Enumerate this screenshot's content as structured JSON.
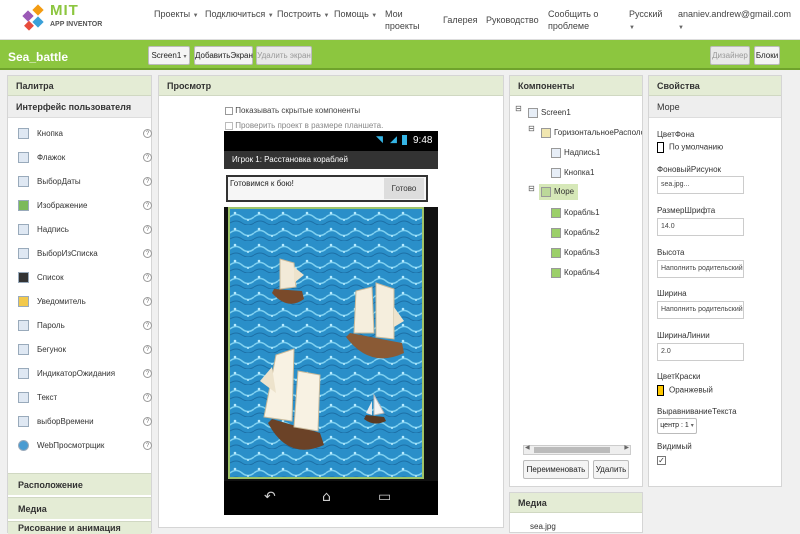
{
  "app": {
    "logo_top": "MIT",
    "logo_bottom": "APP INVENTOR"
  },
  "nav": [
    {
      "label": "Проекты",
      "dropdown": true
    },
    {
      "label": "Подключиться",
      "dropdown": true
    },
    {
      "label": "Построить",
      "dropdown": true
    },
    {
      "label": "Помощь",
      "dropdown": true
    },
    {
      "label": "Мои проекты",
      "dropdown": false
    },
    {
      "label": "Галерея",
      "dropdown": false
    },
    {
      "label": "Руководство",
      "dropdown": false
    },
    {
      "label": "Сообщить о проблеме",
      "dropdown": false
    },
    {
      "label": "Русский",
      "dropdown": true
    },
    {
      "label": "ananiev.andrew@gmail.com",
      "dropdown": true
    }
  ],
  "toolbar": {
    "project_name": "Sea_battle",
    "screen_select": "Screen1",
    "add_screen": "ДобавитьЭкран",
    "remove_screen": "Удалить экран",
    "designer": "Дизайнер",
    "blocks": "Блоки"
  },
  "palette": {
    "title": "Палитра",
    "section": "Интерфейс пользователя",
    "items": [
      {
        "label": "Кнопка",
        "icon": "button-icon"
      },
      {
        "label": "Флажок",
        "icon": "checkbox-icon"
      },
      {
        "label": "ВыборДаты",
        "icon": "datepicker-icon"
      },
      {
        "label": "Изображение",
        "icon": "image-icon"
      },
      {
        "label": "Надпись",
        "icon": "label-icon"
      },
      {
        "label": "ВыборИзСписка",
        "icon": "listpicker-icon"
      },
      {
        "label": "Список",
        "icon": "listview-icon"
      },
      {
        "label": "Уведомитель",
        "icon": "notifier-icon"
      },
      {
        "label": "Пароль",
        "icon": "password-icon"
      },
      {
        "label": "Бегунок",
        "icon": "slider-icon"
      },
      {
        "label": "ИндикаторОжидания",
        "icon": "spinner-icon"
      },
      {
        "label": "Текст",
        "icon": "textbox-icon"
      },
      {
        "label": "выборВремени",
        "icon": "timepicker-icon"
      },
      {
        "label": "WebПросмотрщик",
        "icon": "webviewer-icon"
      }
    ],
    "help_glyph": "?",
    "sections": [
      "Расположение",
      "Медиа",
      "Рисование и анимация"
    ]
  },
  "viewer": {
    "title": "Просмотр",
    "show_hidden": "Показывать скрытые компоненты",
    "tablet_check": "Проверить проект в размере планшета.",
    "clock": "9:48",
    "app_title": "Игрок 1: Расстановка кораблей",
    "label_text": "Готовимся к бою!",
    "button_text": "Готово"
  },
  "components": {
    "title": "Компоненты",
    "tree": [
      {
        "label": "Screen1",
        "level": 0,
        "toggle": "⊟"
      },
      {
        "label": "ГоризонтальноеРасполо",
        "level": 1,
        "toggle": "⊟"
      },
      {
        "label": "Надпись1",
        "level": 2,
        "toggle": ""
      },
      {
        "label": "Кнопка1",
        "level": 2,
        "toggle": ""
      },
      {
        "label": "Море",
        "level": 1,
        "toggle": "⊟",
        "selected": true
      },
      {
        "label": "Корабль1",
        "level": 2,
        "toggle": ""
      },
      {
        "label": "Корабль2",
        "level": 2,
        "toggle": ""
      },
      {
        "label": "Корабль3",
        "level": 2,
        "toggle": ""
      },
      {
        "label": "Корабль4",
        "level": 2,
        "toggle": ""
      }
    ],
    "rename": "Переименовать",
    "delete": "Удалить"
  },
  "media": {
    "title": "Медиа",
    "files": [
      "sea.jpg"
    ]
  },
  "properties": {
    "title": "Свойства",
    "component": "Море",
    "bg_color_label": "ЦветФона",
    "bg_color_value": "По умолчанию",
    "bg_image_label": "ФоновыйРисунок",
    "bg_image_value": "sea.jpg...",
    "font_size_label": "РазмерШрифта",
    "font_size_value": "14.0",
    "height_label": "Высота",
    "height_value": "Наполнить родительский...",
    "width_label": "Ширина",
    "width_value": "Наполнить родительский...",
    "line_width_label": "ШиринаЛинии",
    "line_width_value": "2.0",
    "paint_color_label": "ЦветКраски",
    "paint_color_value": "Оранжевый",
    "text_align_label": "ВыравниваниеТекста",
    "text_align_value": "центр : 1",
    "visible_label": "Видимый",
    "visible_checked": true
  },
  "colors": {
    "accent": "#8cc63f",
    "paint": "#ffc800",
    "sea": "#2a8fc9"
  }
}
